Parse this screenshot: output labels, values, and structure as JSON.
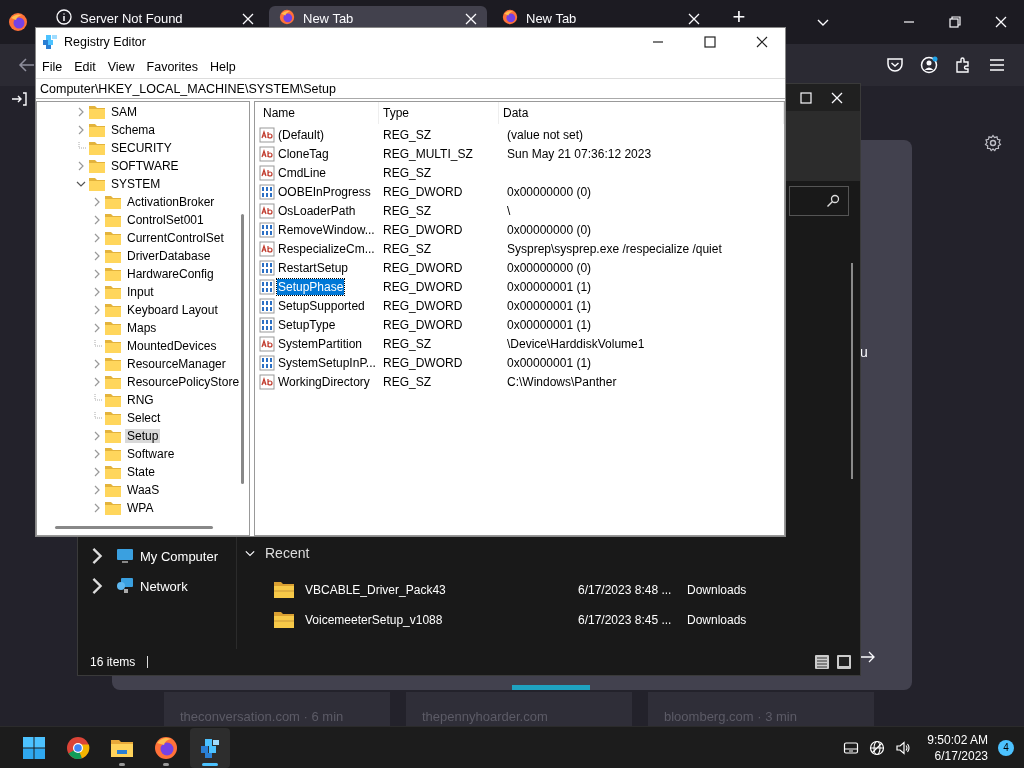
{
  "browser": {
    "tabs": [
      {
        "label": "Server Not Found",
        "kind": "info",
        "selected": false
      },
      {
        "label": "New Tab",
        "kind": "firefox",
        "selected": true
      },
      {
        "label": "New Tab",
        "kind": "firefox",
        "selected": false
      }
    ],
    "new_tab": "+",
    "card_text": "u",
    "news_sources": [
      "theconversation.com · 6 min",
      "thepennyhoarder.com",
      "bloomberg.com · 3 min"
    ]
  },
  "explorer": {
    "nav_items": [
      {
        "label": "My Computer",
        "kind": "computer"
      },
      {
        "label": "Network",
        "kind": "network"
      }
    ],
    "section": "Recent",
    "files": [
      {
        "name": "VBCABLE_Driver_Pack43",
        "date": "6/17/2023 8:48 ...",
        "location": "Downloads"
      },
      {
        "name": "VoicemeeterSetup_v1088",
        "date": "6/17/2023 8:45 ...",
        "location": "Downloads"
      }
    ],
    "status": "16 items"
  },
  "registry": {
    "title": "Registry Editor",
    "menu": [
      "File",
      "Edit",
      "View",
      "Favorites",
      "Help"
    ],
    "address": "Computer\\HKEY_LOCAL_MACHINE\\SYSTEM\\Setup",
    "tree": [
      {
        "label": "SAM",
        "expandable": true,
        "expanded": false,
        "selected": false
      },
      {
        "label": "Schema",
        "expandable": true,
        "expanded": false,
        "selected": false
      },
      {
        "label": "SECURITY",
        "expandable": false,
        "selected": false
      },
      {
        "label": "SOFTWARE",
        "expandable": true,
        "expanded": false,
        "selected": false
      },
      {
        "label": "SYSTEM",
        "expandable": true,
        "expanded": true,
        "selected": false,
        "children": [
          {
            "label": "ActivationBroker",
            "expandable": true,
            "expanded": false,
            "selected": false
          },
          {
            "label": "ControlSet001",
            "expandable": true,
            "expanded": false,
            "selected": false
          },
          {
            "label": "CurrentControlSet",
            "expandable": true,
            "expanded": false,
            "selected": false
          },
          {
            "label": "DriverDatabase",
            "expandable": true,
            "expanded": false,
            "selected": false
          },
          {
            "label": "HardwareConfig",
            "expandable": true,
            "expanded": false,
            "selected": false
          },
          {
            "label": "Input",
            "expandable": true,
            "expanded": false,
            "selected": false
          },
          {
            "label": "Keyboard Layout",
            "expandable": true,
            "expanded": false,
            "selected": false
          },
          {
            "label": "Maps",
            "expandable": true,
            "expanded": false,
            "selected": false
          },
          {
            "label": "MountedDevices",
            "expandable": false,
            "selected": false
          },
          {
            "label": "ResourceManager",
            "expandable": true,
            "expanded": false,
            "selected": false
          },
          {
            "label": "ResourcePolicyStore",
            "expandable": true,
            "expanded": false,
            "selected": false
          },
          {
            "label": "RNG",
            "expandable": false,
            "selected": false
          },
          {
            "label": "Select",
            "expandable": false,
            "selected": false
          },
          {
            "label": "Setup",
            "expandable": true,
            "expanded": false,
            "selected": true
          },
          {
            "label": "Software",
            "expandable": true,
            "expanded": false,
            "selected": false
          },
          {
            "label": "State",
            "expandable": true,
            "expanded": false,
            "selected": false
          },
          {
            "label": "WaaS",
            "expandable": true,
            "expanded": false,
            "selected": false
          },
          {
            "label": "WPA",
            "expandable": true,
            "expanded": false,
            "selected": false
          }
        ]
      }
    ],
    "columns": [
      "Name",
      "Type",
      "Data"
    ],
    "values": [
      {
        "name": "(Default)",
        "type": "REG_SZ",
        "data": "(value not set)",
        "kind": "string",
        "selected": false
      },
      {
        "name": "CloneTag",
        "type": "REG_MULTI_SZ",
        "data": "Sun May 21 07:36:12 2023",
        "kind": "string",
        "selected": false
      },
      {
        "name": "CmdLine",
        "type": "REG_SZ",
        "kind": "string",
        "selected": false
      },
      {
        "name": "OOBEInProgress",
        "type": "REG_DWORD",
        "data": "0x00000000 (0)",
        "kind": "binary",
        "selected": false
      },
      {
        "name": "OsLoaderPath",
        "type": "REG_SZ",
        "data": "\\",
        "kind": "string",
        "selected": false
      },
      {
        "name": "RemoveWindow...",
        "type": "REG_DWORD",
        "data": "0x00000000 (0)",
        "kind": "binary",
        "selected": false
      },
      {
        "name": "RespecializeCm...",
        "type": "REG_SZ",
        "data": "Sysprep\\sysprep.exe /respecialize /quiet",
        "kind": "string",
        "selected": false
      },
      {
        "name": "RestartSetup",
        "type": "REG_DWORD",
        "data": "0x00000000 (0)",
        "kind": "binary",
        "selected": false
      },
      {
        "name": "SetupPhase",
        "type": "REG_DWORD",
        "data": "0x00000001 (1)",
        "kind": "binary",
        "selected": true
      },
      {
        "name": "SetupSupported",
        "type": "REG_DWORD",
        "data": "0x00000001 (1)",
        "kind": "binary",
        "selected": false
      },
      {
        "name": "SetupType",
        "type": "REG_DWORD",
        "data": "0x00000001 (1)",
        "kind": "binary",
        "selected": false
      },
      {
        "name": "SystemPartition",
        "type": "REG_SZ",
        "data": "\\Device\\HarddiskVolume1",
        "kind": "string",
        "selected": false
      },
      {
        "name": "SystemSetupInP...",
        "type": "REG_DWORD",
        "data": "0x00000001 (1)",
        "kind": "binary",
        "selected": false
      },
      {
        "name": "WorkingDirectory",
        "type": "REG_SZ",
        "data": "C:\\Windows\\Panther",
        "kind": "string",
        "selected": false
      }
    ]
  },
  "taskbar": {
    "apps": [
      {
        "kind": "start",
        "running": false,
        "active": false
      },
      {
        "kind": "chrome",
        "running": false,
        "active": false
      },
      {
        "kind": "folder",
        "running": true,
        "active": false
      },
      {
        "kind": "firefox",
        "running": true,
        "active": false
      },
      {
        "kind": "registry",
        "running": true,
        "active": true
      }
    ],
    "time": "9:50:02 AM",
    "date": "6/17/2023",
    "badge": "4"
  }
}
